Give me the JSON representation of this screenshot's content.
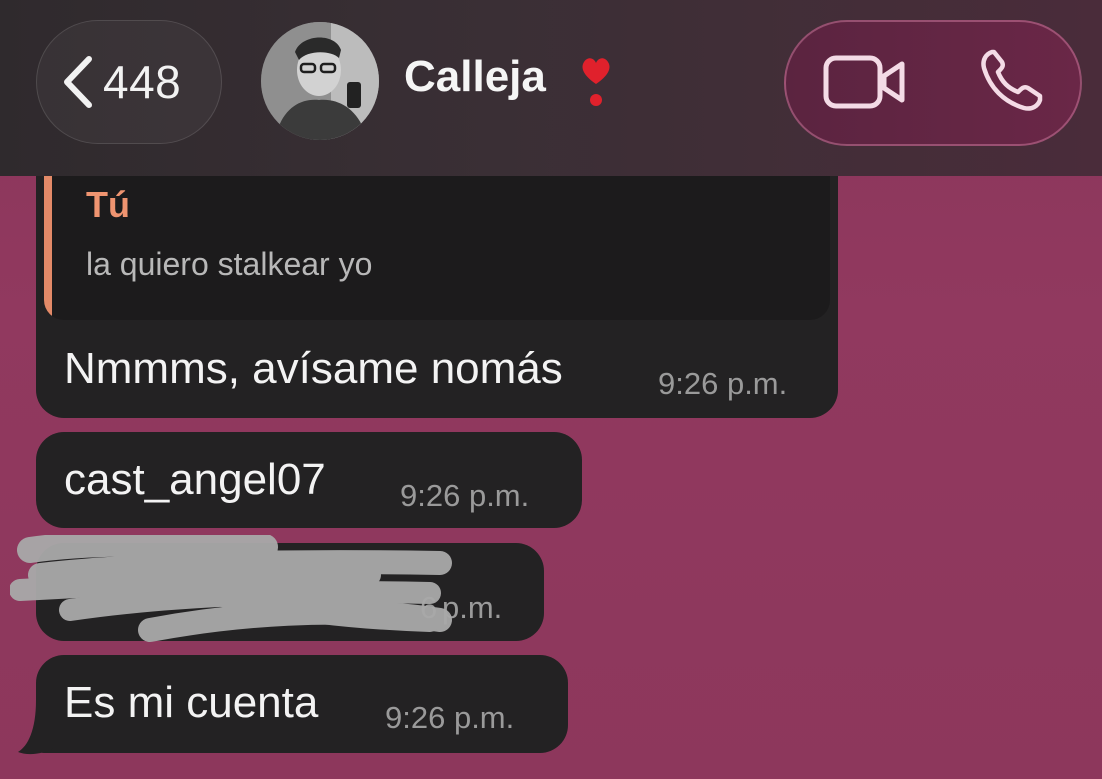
{
  "header": {
    "back_count": "448",
    "contact_name": "Calleja",
    "heart_emoji": "❣",
    "icons": [
      "back-chevron-icon",
      "video-call-icon",
      "phone-call-icon",
      "heart-exclamation-icon"
    ]
  },
  "messages": [
    {
      "reply": {
        "author": "Tú",
        "text": "la quiero stalkear yo"
      },
      "text": "Nmmms, avísame nomás",
      "time": "9:26 p.m."
    },
    {
      "text": "cast_angel07",
      "time": "9:26 p.m."
    },
    {
      "text": "",
      "time": "p.m.",
      "time_prefix_visible": "6",
      "redacted": true
    },
    {
      "text": "Es mi cuenta",
      "time": "9:26 p.m."
    }
  ],
  "colors": {
    "chat_background": "#8e3a5e",
    "bubble": "#232223",
    "reply_accent": "#e38a68",
    "call_pill": "#5b2440"
  }
}
